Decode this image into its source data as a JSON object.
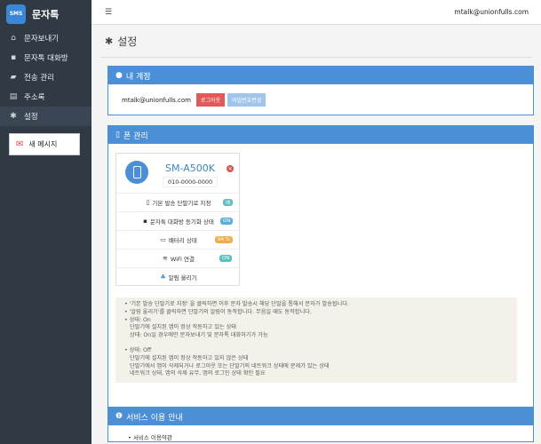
{
  "app": {
    "logo_text": "SMS",
    "logo_subtext": "Talk",
    "name": "문자톡"
  },
  "sidebar": {
    "items": [
      {
        "icon": "home-icon",
        "glyph": "⌂",
        "label": "문자보내기"
      },
      {
        "icon": "chat-icon",
        "glyph": "💬",
        "label": "문자톡 대화방"
      },
      {
        "icon": "folder-icon",
        "glyph": "▰",
        "label": "전송 관리"
      },
      {
        "icon": "address-book-icon",
        "glyph": "▤",
        "label": "주소록"
      },
      {
        "icon": "gear-icon",
        "glyph": "✱",
        "label": "설정"
      }
    ],
    "new_message_label": "새 메시지"
  },
  "topbar": {
    "menu_glyph": "☰",
    "user_email": "mtalk@unionfulls.com"
  },
  "page": {
    "title": "설정"
  },
  "account_panel": {
    "title": "내 계정",
    "email": "mtalk@unionfulls.com",
    "logout_label": "로그아웃",
    "change_password_label": "비밀번호변경"
  },
  "phone_panel": {
    "title": "폰 관리",
    "model": "SM-A500K",
    "number": "010-0000-0000",
    "rows": [
      {
        "label": "기본 발송 단말기로 지정",
        "badge": "예",
        "color": "#5bc0be"
      },
      {
        "label": "문자톡 대화방 동기화 상태",
        "badge": "ON",
        "color": "#5bb0d9"
      },
      {
        "label": "배터리 상태",
        "badge": "94 %",
        "color": "#f0ad4e"
      },
      {
        "label": "WiFi 연결",
        "badge": "ON",
        "color": "#5bc0be"
      },
      {
        "label": "알림 울리기",
        "badge": "",
        "color": ""
      }
    ],
    "notes": [
      "• '기본 발송 단말기로 지정' 을 클릭하면 이후 문자 발송시 해당 단말을 통해서 문자가 발송됩니다.",
      "• '알림 울리기'를 클릭하면 단말기의 알림이 동작합니다. 무음일 때도 동작합니다.",
      "• 상태: On",
      "  단말기에 설치된 앱이 정상 작동하고 있는 상태",
      "  상태: On일 경우에만 문자보내기 및 문자톡 대화하기가 가능",
      "• 상태: Off",
      "  단말기에 설치된 앱이 정상 작동하고 있지 않은 상태",
      "  단말기에서 앱이 삭제되거나 로그아웃 또는 단말기의 네트워크 상태에 문제가 있는 상태",
      "  네트워크 상태, 앱의 삭제 유무, 앱의 로그인 상태 확인 필요"
    ]
  },
  "service_panel": {
    "title": "서비스 이용 안내",
    "items": [
      "• 서비스 이용약관"
    ]
  }
}
